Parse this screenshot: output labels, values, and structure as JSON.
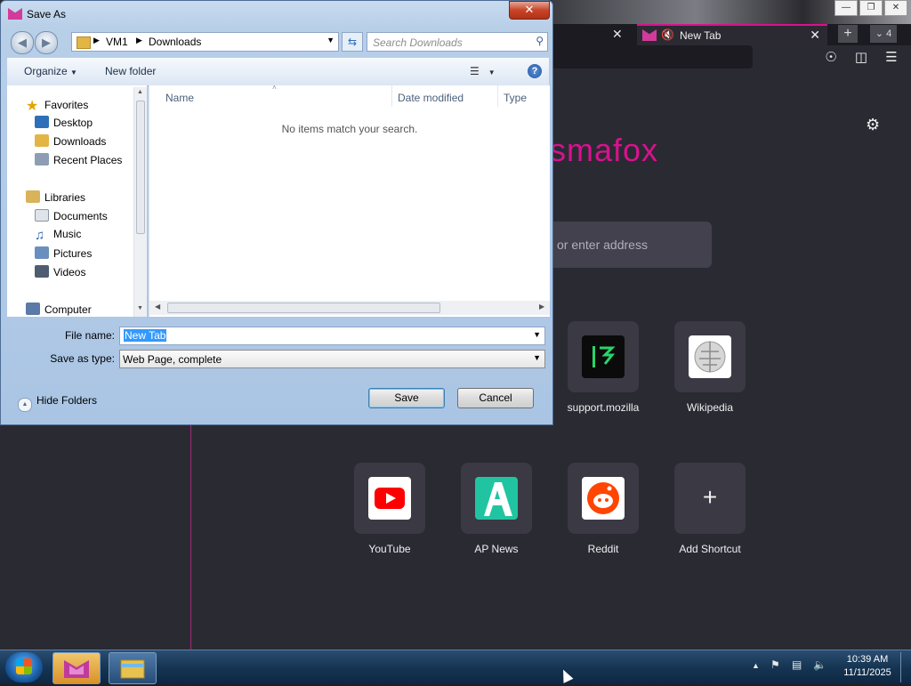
{
  "browser": {
    "tab_title": "New Tab",
    "tab_count": "4",
    "brand_text": "smafox",
    "search_placeholder": "or enter address",
    "shortcuts": [
      {
        "label": "support.mozilla",
        "icon": "support-mozilla-icon"
      },
      {
        "label": "Wikipedia",
        "icon": "wikipedia-icon"
      },
      {
        "label": "YouTube",
        "icon": "youtube-icon"
      },
      {
        "label": "AP News",
        "icon": "ap-news-icon"
      },
      {
        "label": "Reddit",
        "icon": "reddit-icon"
      },
      {
        "label": "Add Shortcut",
        "icon": "plus-icon"
      }
    ],
    "accent_color": "#d7128d"
  },
  "dialog": {
    "title": "Save As",
    "address": {
      "segments": [
        "VM1",
        "Downloads"
      ]
    },
    "search_placeholder": "Search Downloads",
    "toolbar": {
      "organize": "Organize",
      "new_folder": "New folder"
    },
    "nav": {
      "favorites": "Favorites",
      "desktop": "Desktop",
      "downloads": "Downloads",
      "recent_places": "Recent Places",
      "libraries": "Libraries",
      "documents": "Documents",
      "music": "Music",
      "pictures": "Pictures",
      "videos": "Videos",
      "computer": "Computer"
    },
    "columns": [
      "Name",
      "Date modified",
      "Type"
    ],
    "empty_message": "No items match your search.",
    "file_name_label": "File name:",
    "file_name_value": "New Tab",
    "save_type_label": "Save as type:",
    "save_type_value": "Web Page, complete",
    "hide_folders": "Hide Folders",
    "save_button": "Save",
    "cancel_button": "Cancel"
  },
  "taskbar": {
    "time": "10:39 AM",
    "date": "11/11/2025"
  }
}
